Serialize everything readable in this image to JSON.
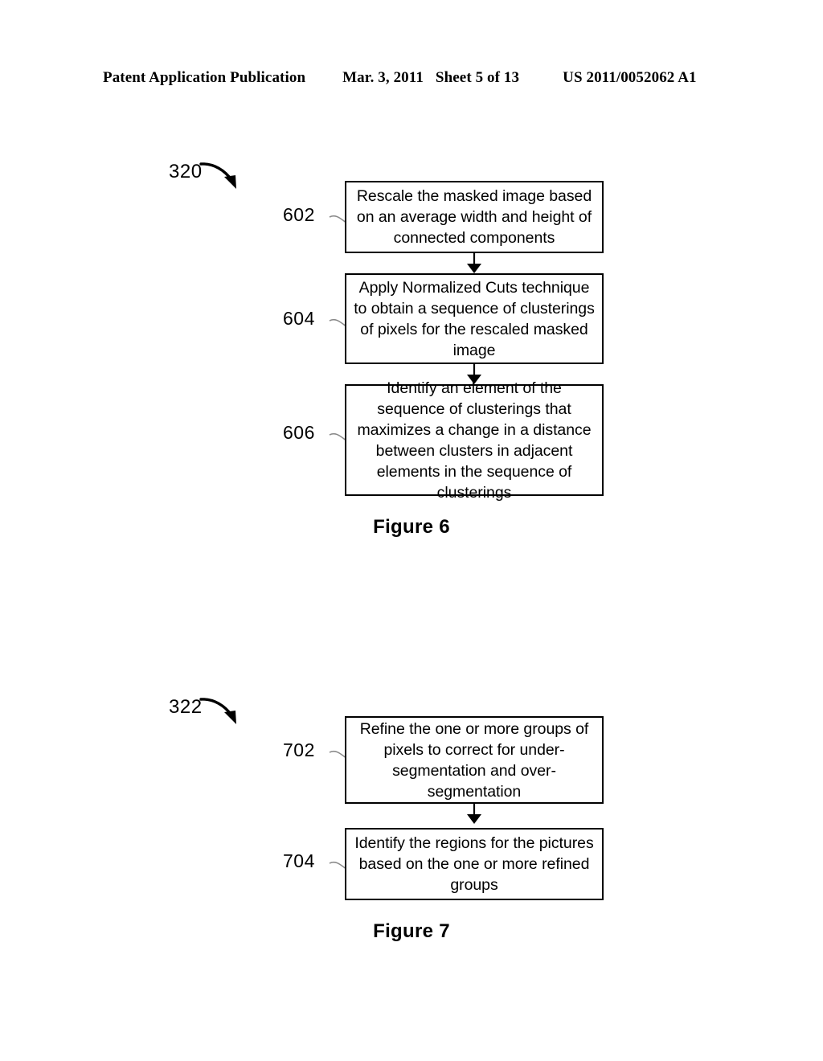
{
  "header": {
    "publication": "Patent Application Publication",
    "date": "Mar. 3, 2011",
    "sheet": "Sheet 5 of 13",
    "document_number": "US 2011/0052062 A1"
  },
  "figures": [
    {
      "id": "figure-6",
      "caption": "Figure 6",
      "flow_tag": "320",
      "steps": [
        {
          "ref": "602",
          "text": "Rescale the masked image based on an average width and height of connected components"
        },
        {
          "ref": "604",
          "text": "Apply Normalized Cuts technique to obtain a sequence of clusterings of pixels for the rescaled masked image"
        },
        {
          "ref": "606",
          "text": "Identify an element of the sequence of clusterings that maximizes a change in a distance between clusters in adjacent elements in the sequence of clusterings"
        }
      ]
    },
    {
      "id": "figure-7",
      "caption": "Figure 7",
      "flow_tag": "322",
      "steps": [
        {
          "ref": "702",
          "text": "Refine the one or more groups of pixels to correct for under-segmentation and over-segmentation"
        },
        {
          "ref": "704",
          "text": "Identify the regions for the pictures based on the one or more refined groups"
        }
      ]
    }
  ],
  "colors": {
    "ink": "#000000",
    "paper": "#ffffff",
    "leader_line": "#8a8a8a"
  }
}
